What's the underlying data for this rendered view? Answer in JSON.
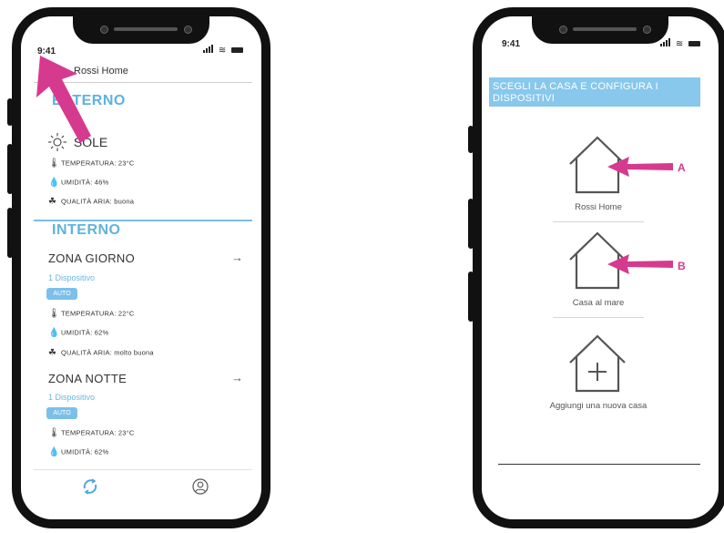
{
  "left_phone": {
    "status_time": "9:41",
    "header_title": "Rossi Home",
    "esterno": {
      "title": "ESTERNO",
      "weather": "SOLE",
      "rows": [
        {
          "icon": "thermometer-icon",
          "text": "TEMPERATURA: 23°C"
        },
        {
          "icon": "drop-icon",
          "text": "UMIDITÀ: 46%"
        },
        {
          "icon": "air-quality-icon",
          "text": "QUALITÀ ARIA: buona"
        }
      ]
    },
    "interno": {
      "title": "INTERNO",
      "zones": [
        {
          "name": "ZONA GIORNO",
          "devices": "1 Dispositivo",
          "mode": "AUTO",
          "rows": [
            {
              "icon": "thermometer-icon",
              "text": "TEMPERATURA: 22°C"
            },
            {
              "icon": "drop-icon",
              "text": "UMIDITÀ: 62%"
            },
            {
              "icon": "air-quality-icon",
              "text": "QUALITÀ ARIA: molto buona"
            }
          ]
        },
        {
          "name": "ZONA NOTTE",
          "devices": "1 Dispositivo",
          "mode": "AUTO",
          "rows": [
            {
              "icon": "thermometer-icon",
              "text": "TEMPERATURA: 23°C"
            },
            {
              "icon": "drop-icon",
              "text": "UMIDITÀ: 62%"
            }
          ]
        }
      ]
    },
    "nav": {
      "left_icon": "sync-icon",
      "right_icon": "user-icon"
    }
  },
  "right_phone": {
    "status_time": "9:41",
    "banner": "SCEGLI LA CASA E CONFIGURA I DISPOSITIVI",
    "houses": [
      {
        "label": "Rossi Home",
        "marker": "A"
      },
      {
        "label": "Casa al mare",
        "marker": "B"
      },
      {
        "label": "Aggiungi una nuova casa",
        "marker": ""
      }
    ]
  },
  "colors": {
    "accent_blue": "#5eb3e0",
    "banner_blue": "#87c8ec",
    "arrow_pink": "#d63a8e",
    "phone_frame": "#111111"
  }
}
